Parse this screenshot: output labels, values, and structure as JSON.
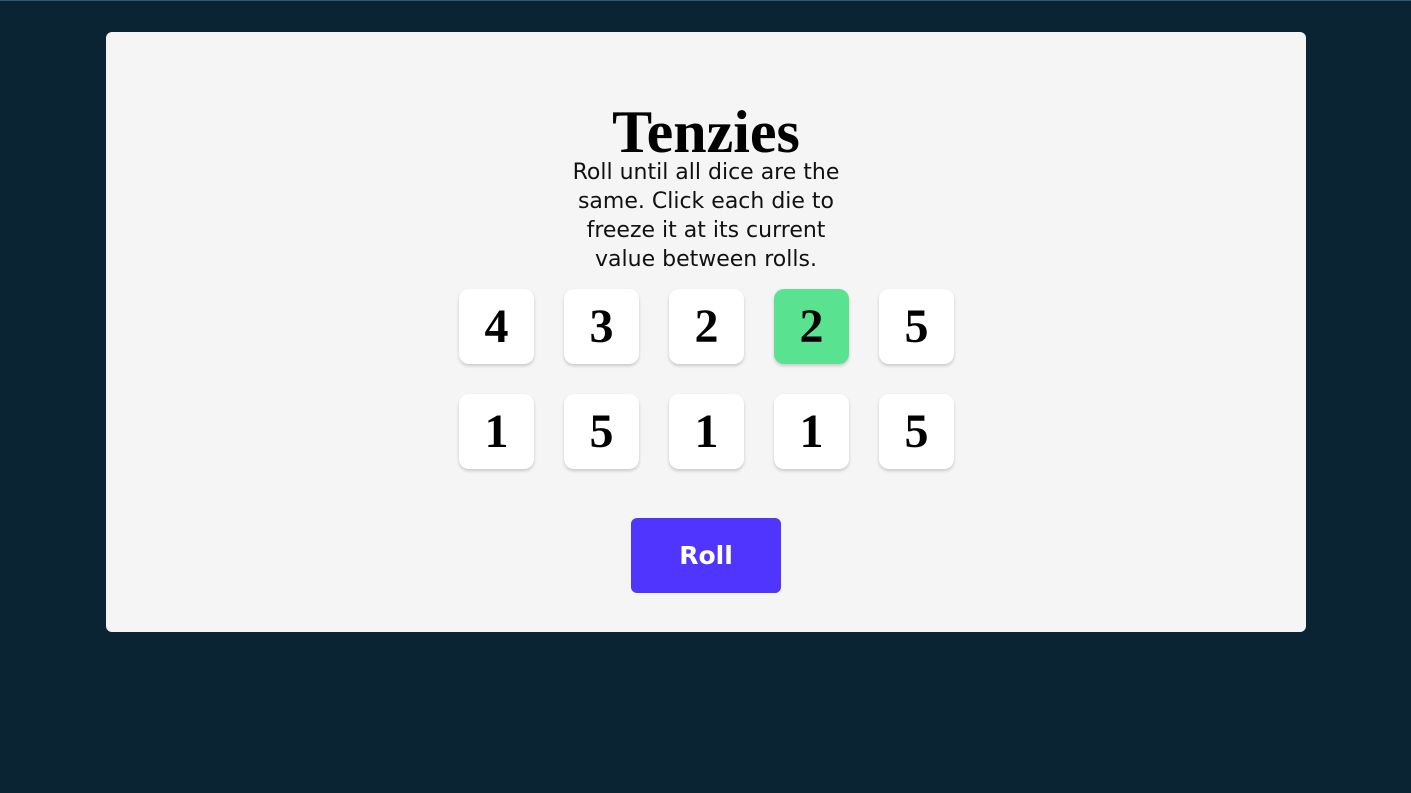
{
  "app": {
    "title": "Tenzies",
    "instructions": "Roll until all dice are the same. Click each die to freeze it at its current value between rolls."
  },
  "dice": [
    {
      "value": "4",
      "held": false
    },
    {
      "value": "3",
      "held": false
    },
    {
      "value": "2",
      "held": false
    },
    {
      "value": "2",
      "held": true
    },
    {
      "value": "5",
      "held": false
    },
    {
      "value": "1",
      "held": false
    },
    {
      "value": "5",
      "held": false
    },
    {
      "value": "1",
      "held": false
    },
    {
      "value": "1",
      "held": false
    },
    {
      "value": "5",
      "held": false
    }
  ],
  "controls": {
    "roll_label": "Roll"
  },
  "colors": {
    "background": "#0b2434",
    "card": "#f5f5f5",
    "die": "#ffffff",
    "die_held": "#59e391",
    "accent": "#5035ff"
  }
}
